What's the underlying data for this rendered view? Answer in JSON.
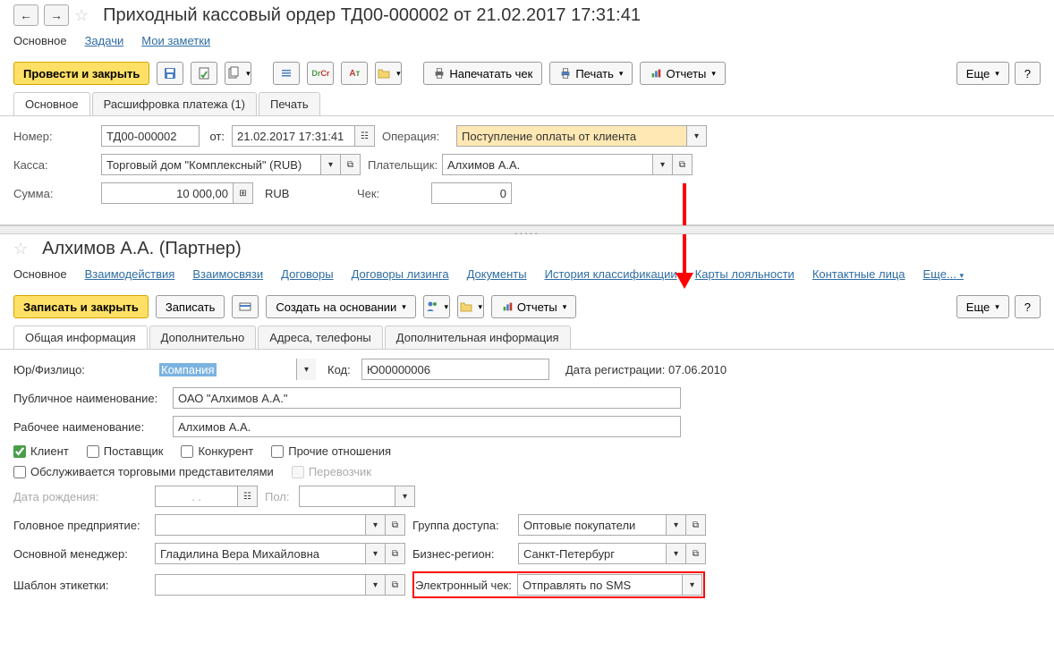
{
  "top": {
    "title": "Приходный кассовый ордер ТД00-000002 от 21.02.2017 17:31:41",
    "subnav": [
      "Основное",
      "Задачи",
      "Мои заметки"
    ],
    "buttons": {
      "main": "Провести и закрыть",
      "print_check": "Напечатать чек",
      "print": "Печать",
      "reports": "Отчеты",
      "more": "Еще",
      "help": "?"
    },
    "tabs": [
      "Основное",
      "Расшифровка платежа (1)",
      "Печать"
    ],
    "labels": {
      "number": "Номер:",
      "from": "от:",
      "operation": "Операция:",
      "kassa": "Касса:",
      "payer": "Плательщик:",
      "sum": "Сумма:",
      "currency": "RUB",
      "check": "Чек:"
    },
    "values": {
      "number": "ТД00-000002",
      "date": "21.02.2017 17:31:41",
      "operation": "Поступление оплаты от клиента",
      "kassa": "Торговый дом \"Комплексный\" (RUB)",
      "payer": "Алхимов А.А.",
      "sum": "10 000,00",
      "check": "0"
    }
  },
  "bottom": {
    "title": "Алхимов А.А. (Партнер)",
    "subnav": [
      "Основное",
      "Взаимодействия",
      "Взаимосвязи",
      "Договоры",
      "Договоры лизинга",
      "Документы",
      "История классификации",
      "Карты лояльности",
      "Контактные лица",
      "Еще..."
    ],
    "buttons": {
      "save_close": "Записать и закрыть",
      "save": "Записать",
      "create_based": "Создать на основании",
      "reports": "Отчеты",
      "more": "Еще",
      "help": "?"
    },
    "tabs": [
      "Общая информация",
      "Дополнительно",
      "Адреса, телефоны",
      "Дополнительная информация"
    ],
    "labels": {
      "legal": "Юр/Физлицо:",
      "code": "Код:",
      "reg_date_label": "Дата регистрации:",
      "public_name": "Публичное наименование:",
      "work_name": "Рабочее наименование:",
      "client": "Клиент",
      "supplier": "Поставщик",
      "competitor": "Конкурент",
      "other_rel": "Прочие отношения",
      "served_by": "Обслуживается торговыми представителями",
      "carrier": "Перевозчик",
      "birth": "Дата рождения:",
      "gender": "Пол:",
      "head_org": "Головное предприятие:",
      "access_group": "Группа доступа:",
      "main_manager": "Основной менеджер:",
      "business_region": "Бизнес-регион:",
      "label_template": "Шаблон этикетки:",
      "echeck": "Электронный чек:"
    },
    "values": {
      "legal": "Компания",
      "code": "Ю00000006",
      "reg_date": "07.06.2010",
      "public_name": "ОАО \"Алхимов А.А.\"",
      "work_name": "Алхимов А.А.",
      "birth_placeholder": ".   .",
      "access_group": "Оптовые покупатели",
      "main_manager": "Гладилина Вера Михайловна",
      "business_region": "Санкт-Петербург",
      "echeck": "Отправлять по SMS"
    }
  }
}
